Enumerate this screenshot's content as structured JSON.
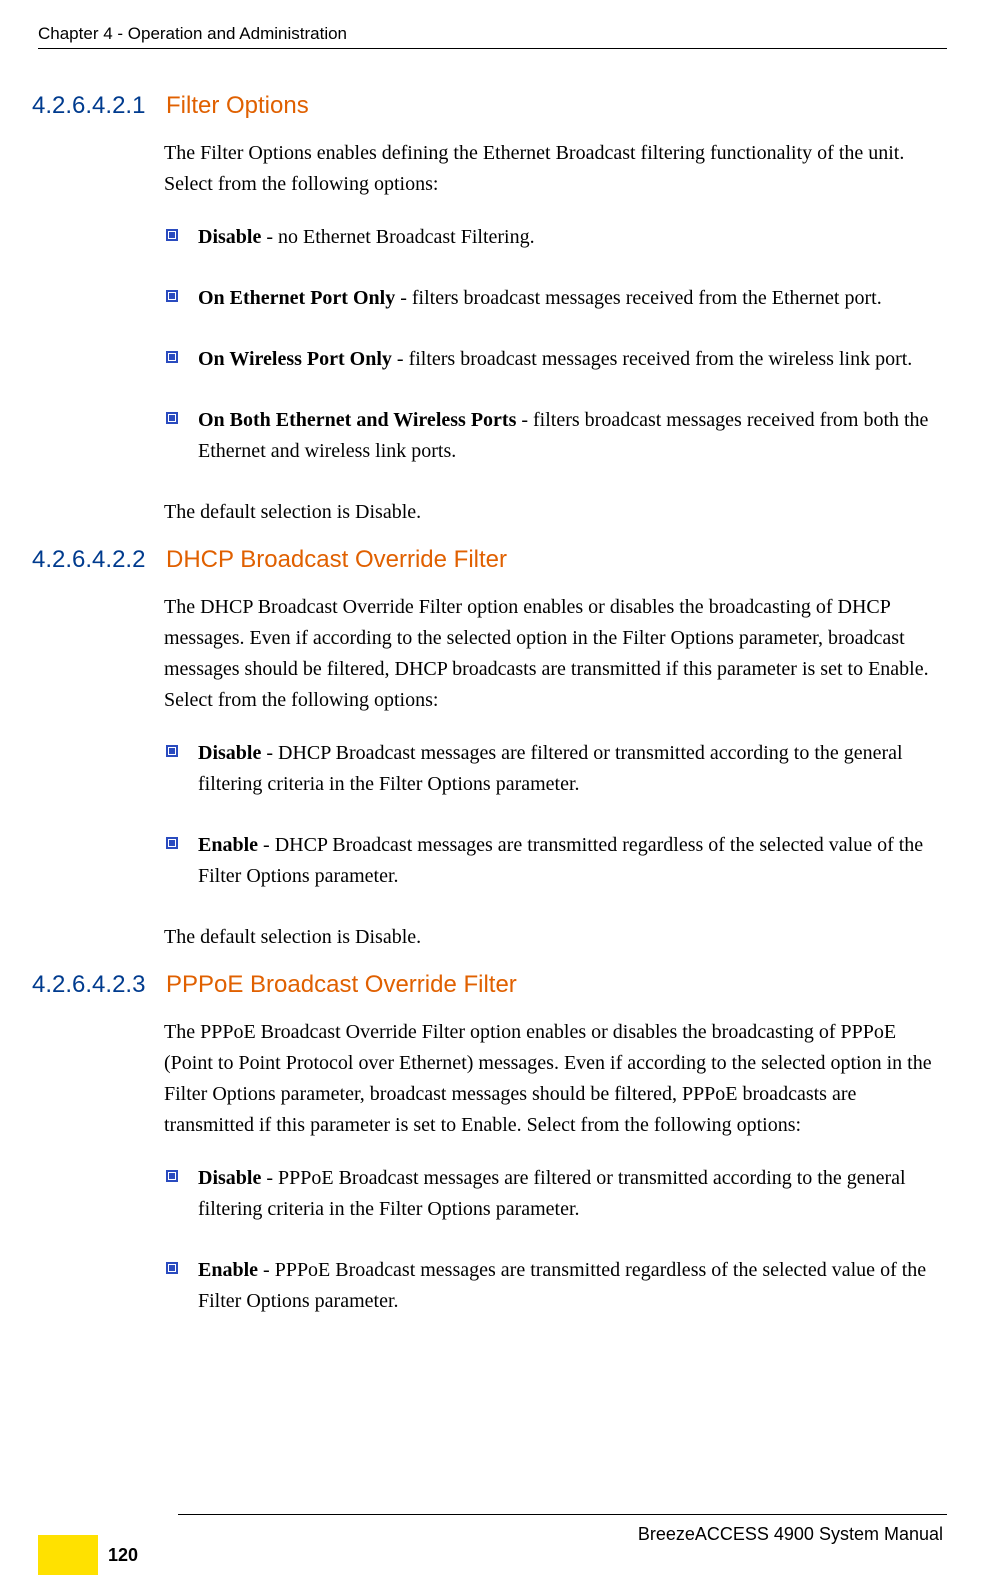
{
  "header": {
    "running": "Chapter 4 - Operation and Administration"
  },
  "sections": [
    {
      "num": "4.2.6.4.2.1",
      "title": "Filter Options",
      "intro": "The Filter Options enables defining the Ethernet Broadcast filtering functionality of the unit. Select from the following options:",
      "bullets": [
        {
          "label": "Disable",
          "text": " - no Ethernet Broadcast Filtering."
        },
        {
          "label": "On Ethernet Port Only",
          "text": " - filters broadcast messages received from the Ethernet port."
        },
        {
          "label": "On Wireless Port Only",
          "text": " - filters broadcast messages received from the wireless link port."
        },
        {
          "label": "On Both Ethernet and Wireless Ports",
          "text": " - filters broadcast messages received from both the Ethernet and wireless link ports."
        }
      ],
      "outro": "The default selection is Disable."
    },
    {
      "num": "4.2.6.4.2.2",
      "title": "DHCP Broadcast Override Filter",
      "intro": "The DHCP Broadcast Override Filter option enables or disables the broadcasting of DHCP messages. Even if according to the selected option in the Filter Options parameter, broadcast messages should be filtered, DHCP broadcasts are transmitted if this parameter is set to Enable. Select from the following options:",
      "bullets": [
        {
          "label": "Disable",
          "text": " - DHCP Broadcast messages are filtered or transmitted according to the general filtering criteria in the Filter Options parameter."
        },
        {
          "label": "Enable",
          "text": " - DHCP Broadcast messages are transmitted regardless of the selected value of the Filter Options parameter."
        }
      ],
      "outro": "The default selection is Disable."
    },
    {
      "num": "4.2.6.4.2.3",
      "title": "PPPoE Broadcast Override Filter",
      "intro": "The PPPoE Broadcast Override Filter option enables or disables the broadcasting of PPPoE (Point to Point Protocol over Ethernet) messages. Even if according to the selected option in the Filter Options parameter, broadcast messages should be filtered, PPPoE broadcasts are transmitted if this parameter is set to Enable. Select from the following options:",
      "bullets": [
        {
          "label": "Disable",
          "text": " - PPPoE Broadcast messages are filtered or transmitted according to the general filtering criteria in the Filter Options parameter."
        },
        {
          "label": "Enable",
          "text": " - PPPoE Broadcast messages are transmitted regardless of the selected value of the Filter Options parameter."
        }
      ],
      "outro": ""
    }
  ],
  "footer": {
    "manual": "BreezeACCESS 4900 System Manual",
    "page": "120"
  }
}
